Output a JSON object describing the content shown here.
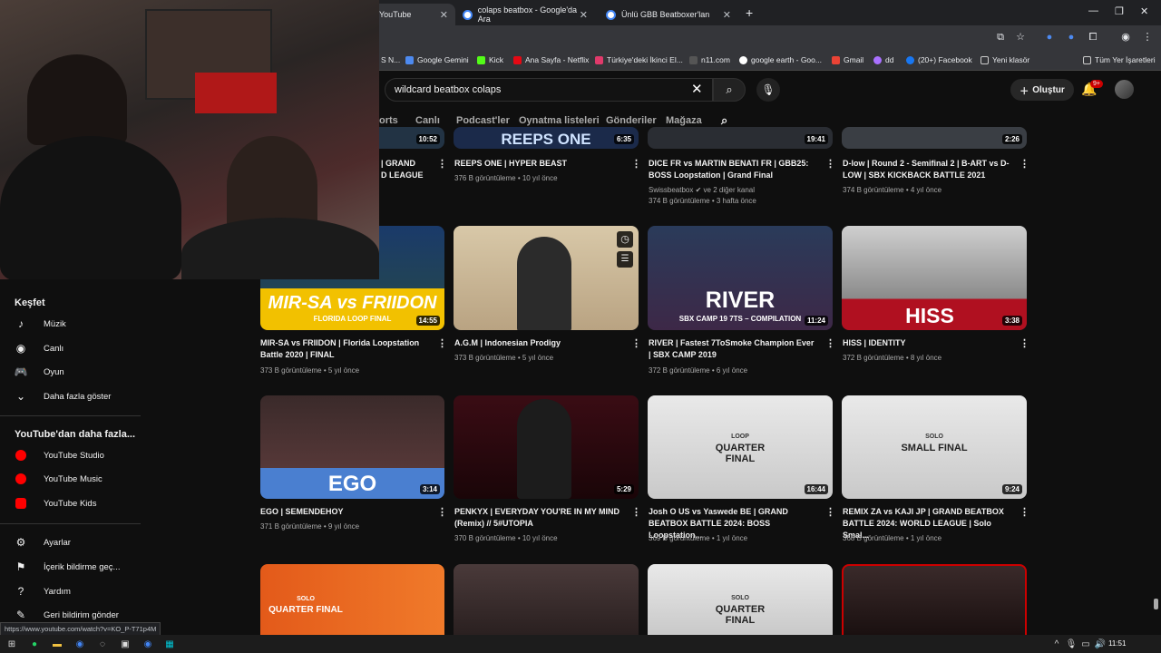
{
  "browser": {
    "tabs": [
      {
        "label": "YouTube"
      },
      {
        "label": "colaps beatbox - Google'da Ara"
      },
      {
        "label": "Ünlü GBB Beatboxer'lan"
      }
    ],
    "new_tab": "+",
    "bookmarks": [
      {
        "label": "S N..."
      },
      {
        "label": "Google Gemini"
      },
      {
        "label": "Kick"
      },
      {
        "label": "Ana Sayfa - Netflix"
      },
      {
        "label": "Türkiye'deki İkinci El..."
      },
      {
        "label": "n11.com"
      },
      {
        "label": "google earth - Goo..."
      },
      {
        "label": "Gmail"
      },
      {
        "label": "dd"
      },
      {
        "label": "(20+) Facebook"
      },
      {
        "label": "Yeni klasör"
      },
      {
        "label": "Tüm Yer İşaretleri"
      }
    ]
  },
  "header": {
    "search_value": "wildcard beatbox colaps",
    "create_label": "Oluştur",
    "notif_count": "9+"
  },
  "chips": [
    "orts",
    "Canlı",
    "Podcast'ler",
    "Oynatma listeleri",
    "Gönderiler",
    "Mağaza"
  ],
  "sidebar": {
    "explore_title": "Keşfet",
    "explore_items": [
      "Müzik",
      "Canlı",
      "Oyun",
      "Daha fazla göster"
    ],
    "more_title": "YouTube'dan daha fazla...",
    "more_items": [
      "YouTube Studio",
      "YouTube Music",
      "YouTube Kids"
    ],
    "settings_items": [
      "Ayarlar",
      "İçerik bildirme geç...",
      "Yardım",
      "Geri bildirim gönder"
    ]
  },
  "videos_row0": [
    {
      "title": "| GRAND\nD LEAGUE",
      "meta": "",
      "duration": "10:52"
    },
    {
      "title": "REEPS ONE | HYPER BEAST",
      "meta": "376 B görüntüleme • 10 yıl önce",
      "duration": "6:35",
      "thumb_text": "REEPS ONE"
    },
    {
      "title": "DICE FR vs MARTIN BENATI FR | GBB25: BOSS Loopstation | Grand Final",
      "channel": "Swissbeatbox",
      "channel_extra": "ve 2 diğer kanal",
      "meta": "374 B görüntüleme • 3 hafta önce",
      "duration": "19:41"
    },
    {
      "title": "D-low | Round 2 - Semifinal 2 | B-ART vs D-LOW | SBX KICKBACK BATTLE 2021",
      "meta": "374 B görüntüleme • 4 yıl önce",
      "duration": "2:26"
    }
  ],
  "videos_row1": [
    {
      "title": "MIR-SA vs FRIIDON | Florida Loopstation Battle 2020 | FINAL",
      "meta": "373 B görüntüleme • 5 yıl önce",
      "duration": "14:55",
      "thumb_text": "MIR-SA vs FRIIDON",
      "thumb_sub": "FLORIDA LOOP FINAL"
    },
    {
      "title": "A.G.M | Indonesian Prodigy",
      "meta": "373 B görüntüleme • 5 yıl önce",
      "duration": ""
    },
    {
      "title": "RIVER | Fastest 7ToSmoke Champion Ever | SBX CAMP 2019",
      "meta": "372 B görüntüleme • 6 yıl önce",
      "duration": "11:24",
      "thumb_text": "RIVER",
      "thumb_sub": "SBX CAMP 19 7TS – COMPILATION"
    },
    {
      "title": "HISS | IDENTITY",
      "meta": "372 B görüntüleme • 8 yıl önce",
      "duration": "3:38",
      "thumb_text": "HISS"
    }
  ],
  "videos_row2": [
    {
      "title": "EGO | SEMENDEHOY",
      "meta": "371 B görüntüleme • 9 yıl önce",
      "duration": "3:14",
      "thumb_text": "EGO"
    },
    {
      "title": "PENKYX | EVERYDAY YOU'RE IN MY MIND (Remix) // 5#UTOPIA",
      "meta": "370 B görüntüleme • 10 yıl önce",
      "duration": "5:29"
    },
    {
      "title": "Josh O US vs Yaswede BE | GRAND BEATBOX BATTLE 2024: BOSS Loopstation...",
      "meta": "369 B görüntüleme • 1 yıl önce",
      "duration": "16:44",
      "thumb_text": "QUARTER FINAL",
      "thumb_sub": "LOOP"
    },
    {
      "title": "REMIX ZA vs KAJI JP | GRAND BEATBOX BATTLE 2024: WORLD LEAGUE | Solo Smal...",
      "meta": "368 B görüntüleme • 1 yıl önce",
      "duration": "9:24",
      "thumb_text": "SMALL FINAL",
      "thumb_sub": "SOLO"
    }
  ],
  "videos_row3": [
    {
      "thumb_text": "QUARTER FINAL",
      "thumb_sub": "SOLO"
    },
    {
      "thumb_text": ""
    },
    {
      "thumb_text": "QUARTER FINAL",
      "thumb_sub": "SOLO"
    },
    {
      "thumb_text": ""
    }
  ],
  "status_url": "https://www.youtube.com/watch?v=KO_P-T71p4M",
  "clock": "11:51",
  "colors": {
    "bg": "#0f0f0f",
    "red": "#ff0000",
    "meta": "#aaaaaa"
  }
}
